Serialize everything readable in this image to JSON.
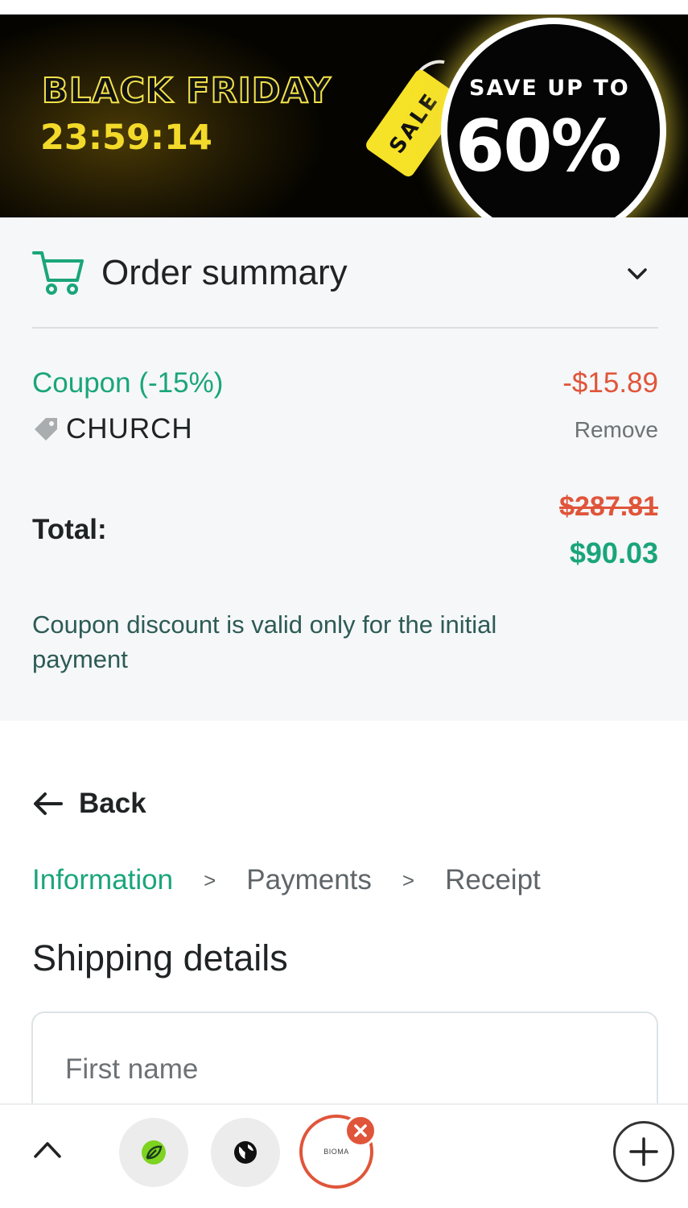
{
  "banner": {
    "title": "BLACK FRIDAY",
    "timer": "23:59:14",
    "tag_text": "SALE",
    "save_label": "SAVE UP TO",
    "save_percent": "60%",
    "colors": {
      "yellow": "#f3da2a",
      "dark": "#050505"
    }
  },
  "summary": {
    "title": "Order summary",
    "icons": {
      "cart": "cart-icon",
      "toggle": "chevron-down-icon",
      "tag": "tag-icon"
    },
    "coupon_label": "Coupon (-15%)",
    "coupon_amount": "-$15.89",
    "coupon_code": "CHURCH",
    "remove_label": "Remove",
    "total_label": "Total:",
    "old_price": "$287.81",
    "new_price": "$90.03",
    "note": "Coupon discount is valid only for the initial payment"
  },
  "nav": {
    "back_label": "Back",
    "steps": [
      {
        "label": "Information",
        "active": true
      },
      {
        "label": "Payments",
        "active": false
      },
      {
        "label": "Receipt",
        "active": false
      }
    ]
  },
  "shipping": {
    "title": "Shipping details",
    "first_name_placeholder": "First name"
  },
  "bottom_bar": {
    "tab3_label": "BIOMA",
    "icons": [
      "chevron-up-icon",
      "leaf-tab-icon",
      "globe-icon",
      "close-icon",
      "plus-icon"
    ]
  },
  "colors": {
    "accent_green": "#1aa57a",
    "accent_red": "#e0553a",
    "summary_bg": "#f5f7f9"
  }
}
